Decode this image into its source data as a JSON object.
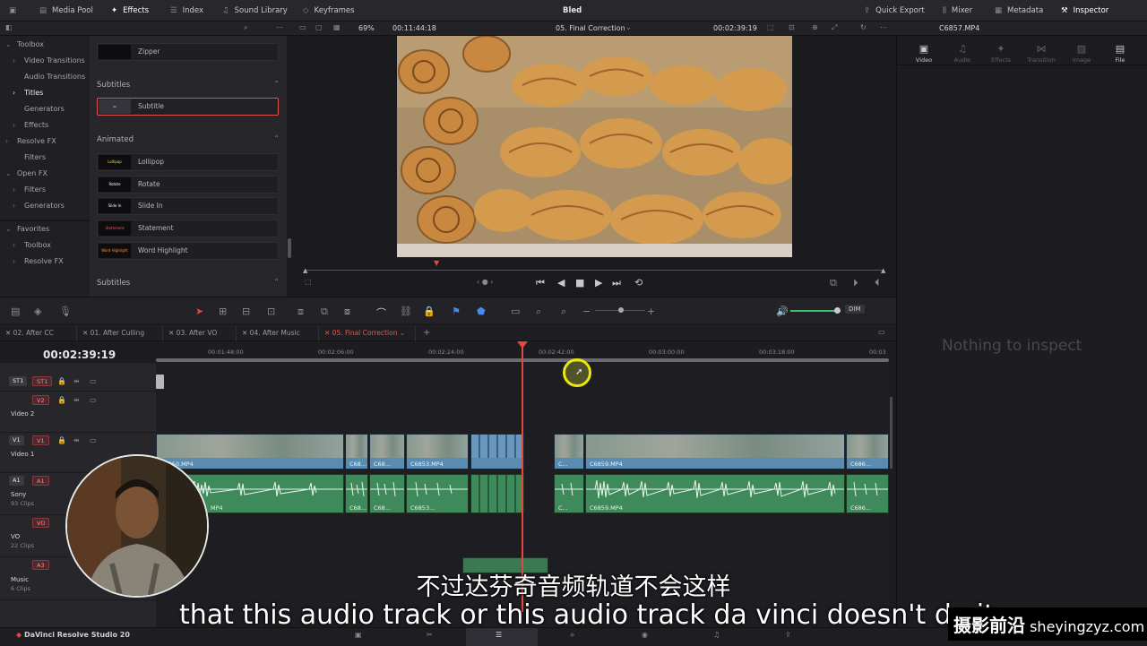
{
  "topbar": {
    "media_pool": "Media Pool",
    "effects": "Effects",
    "index": "Index",
    "sound_library": "Sound Library",
    "keyframes": "Keyframes",
    "project_title": "Bled",
    "quick_export": "Quick Export",
    "mixer": "Mixer",
    "metadata": "Metadata",
    "inspector": "Inspector"
  },
  "viewer_bar": {
    "zoom": "69%",
    "src_timecode": "00:11:44:18",
    "timeline_name": "05. Final Correction",
    "rec_timecode": "00:02:39:19",
    "clip_name": "C6857.MP4"
  },
  "effects_panel": {
    "tree": [
      {
        "label": "Toolbox",
        "level": 0
      },
      {
        "label": "Video Transitions",
        "level": 1
      },
      {
        "label": "Audio Transitions",
        "level": 1
      },
      {
        "label": "Titles",
        "level": 1,
        "selected": true
      },
      {
        "label": "Generators",
        "level": 1
      },
      {
        "label": "Effects",
        "level": 1
      },
      {
        "label": "Resolve FX",
        "level": 0
      },
      {
        "label": "Filters",
        "level": 1
      },
      {
        "label": "Open FX",
        "level": 0
      },
      {
        "label": "Filters",
        "level": 1
      },
      {
        "label": "Generators",
        "level": 1
      }
    ],
    "favorites": {
      "label": "Favorites",
      "items": [
        "Toolbox",
        "Resolve FX"
      ]
    }
  },
  "titles_panel": {
    "zipper": "Zipper",
    "sections": [
      {
        "heading": "Subtitles",
        "items": [
          {
            "label": "Subtitle",
            "thumb": ""
          }
        ]
      },
      {
        "heading": "Animated",
        "items": [
          {
            "label": "Lollipop",
            "thumb": "Lollipop"
          },
          {
            "label": "Rotate",
            "thumb": "Rotate"
          },
          {
            "label": "Slide In",
            "thumb": "Slide In"
          },
          {
            "label": "Statement",
            "thumb": "Statement"
          },
          {
            "label": "Word Highlight",
            "thumb": "Word Highlight"
          }
        ]
      },
      {
        "heading": "Subtitles",
        "items": []
      }
    ]
  },
  "inspector": {
    "tabs": [
      "Video",
      "Audio",
      "Effects",
      "Transition",
      "Image",
      "File"
    ],
    "active_tab": "Video",
    "empty_message": "Nothing to inspect"
  },
  "timeline": {
    "tabs": [
      "02. After CC",
      "01. After Culling",
      "03. After VO",
      "04. After Music",
      "05. Final Correction"
    ],
    "active_tab": "05. Final Correction",
    "timecode": "00:02:39:19",
    "ruler": [
      "00:01:48:00",
      "00:02:06:00",
      "00:02:24:00",
      "00:02:42:00",
      "00:03:00:00",
      "00:03:18:00",
      "00:03"
    ],
    "dim_label": "DIM",
    "tracks": [
      {
        "id": "ST1",
        "label": "ST1",
        "name": "",
        "sub": ""
      },
      {
        "id": "V2",
        "label": "V2",
        "name": "Video 2",
        "sub": ""
      },
      {
        "id": "V1",
        "label": "V1",
        "name": "Video 1",
        "sub": ""
      },
      {
        "id": "A1",
        "label": "A1",
        "name": "Sony",
        "sub": "93 Clips"
      },
      {
        "id": "VO",
        "label": "VO",
        "name": "VO",
        "sub": "22 Clips"
      },
      {
        "id": "A3",
        "label": "A3",
        "name": "Music",
        "sub": "6 Clips"
      }
    ],
    "video_clips": [
      "C6850.MP4",
      "C68...",
      "C68...",
      "C6853.MP4",
      "C...",
      "C6859.MP4",
      "C686..."
    ],
    "audio_clips": [
      "MP4",
      "C68...",
      "C68...",
      "C6853...",
      "C...",
      "C6859.MP4",
      "C686..."
    ]
  },
  "pagebar": {
    "brand": "DaVinci Resolve Studio 20"
  },
  "subtitles": {
    "cn": "不过达芬奇音频轨道不会这样",
    "en": "that this audio track or this audio track da vinci doesn't do it"
  },
  "watermark": {
    "cn": "摄影前沿",
    "url": "sheyingzyz.com"
  },
  "colors": {
    "accent_red": "#e3473f",
    "video_clip": "#5a8bb0",
    "audio_clip": "#3f8a5a",
    "cursor_ring": "#e8e80e"
  }
}
